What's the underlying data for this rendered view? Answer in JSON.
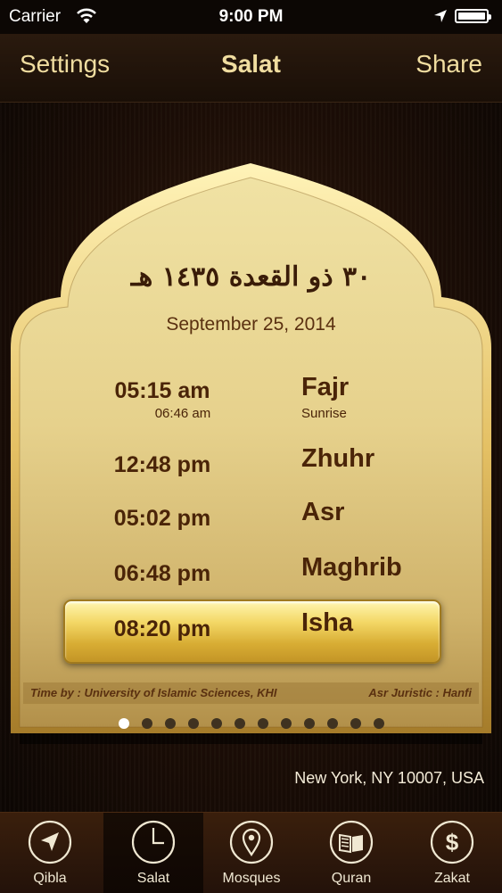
{
  "status_bar": {
    "carrier": "Carrier",
    "time": "9:00 PM"
  },
  "nav": {
    "left_label": "Settings",
    "title": "Salat",
    "right_label": "Share"
  },
  "card": {
    "hijri_date": "٣٠ ذو القعدة ١٤٣٥ هـ",
    "gregorian_date": "September 25, 2014",
    "prayers": [
      {
        "time": "05:15 am",
        "name": "Fajr",
        "sub_time": "06:46 am",
        "sub_name": "Sunrise"
      },
      {
        "time": "12:48 pm",
        "name": "Zhuhr"
      },
      {
        "time": "05:02 pm",
        "name": "Asr"
      },
      {
        "time": "06:48 pm",
        "name": "Maghrib"
      },
      {
        "time": "08:20 pm",
        "name": "Isha",
        "highlighted": true
      }
    ],
    "footer_left": "Time by : University of Islamic Sciences, KHI",
    "footer_right": "Asr Juristic : Hanfi"
  },
  "pager": {
    "count": 12,
    "active_index": 0
  },
  "location": "New York, NY 10007, USA",
  "tabs": [
    {
      "label": "Qibla",
      "icon": "compass-arrow-icon"
    },
    {
      "label": "Salat",
      "icon": "clock-icon",
      "selected": true
    },
    {
      "label": "Mosques",
      "icon": "map-pin-icon"
    },
    {
      "label": "Quran",
      "icon": "book-icon"
    },
    {
      "label": "Zakat",
      "icon": "dollar-icon"
    }
  ],
  "colors": {
    "gold_text": "#f0dda0",
    "prayer_text": "#4a2408",
    "highlight": "#f3d765",
    "background": "#1d0e06"
  }
}
